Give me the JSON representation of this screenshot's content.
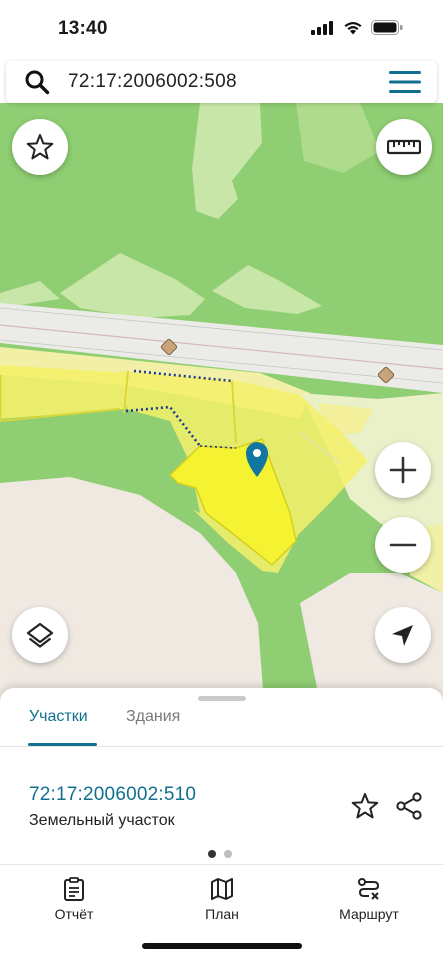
{
  "status_bar": {
    "time": "13:40",
    "icons": [
      "cellular-signal-icon",
      "wifi-icon",
      "battery-icon"
    ]
  },
  "search": {
    "query": "72:17:2006002:508",
    "icons": [
      "search-icon",
      "hamburger-menu-icon"
    ]
  },
  "map": {
    "controls": [
      "favorite-star-icon",
      "ruler-icon",
      "zoom-in-icon",
      "zoom-out-icon",
      "layers-icon",
      "my-location-icon"
    ],
    "marker": "location-pin-icon",
    "colors": {
      "forest": "#8fce72",
      "meadow": "#c7e6a8",
      "road": "#ececec",
      "plot_fill": "#f4f06a",
      "selected_plot": "#f5f232",
      "plot_border": "#d9d63a",
      "boundary_dots": "#1e3a8a",
      "pin": "#1277a0"
    }
  },
  "sheet": {
    "tabs": [
      {
        "label": "Участки",
        "active": true
      },
      {
        "label": "Здания",
        "active": false
      }
    ],
    "parcel": {
      "number": "72:17:2006002:510",
      "type": "Земельный участок"
    },
    "pager": {
      "pages": 2,
      "current": 1
    },
    "accent_color": "#12708f"
  },
  "bottom_nav": {
    "items": [
      {
        "label": "Отчёт",
        "icon": "report-clipboard-icon"
      },
      {
        "label": "План",
        "icon": "map-plan-icon"
      },
      {
        "label": "Маршрут",
        "icon": "route-icon"
      }
    ]
  }
}
